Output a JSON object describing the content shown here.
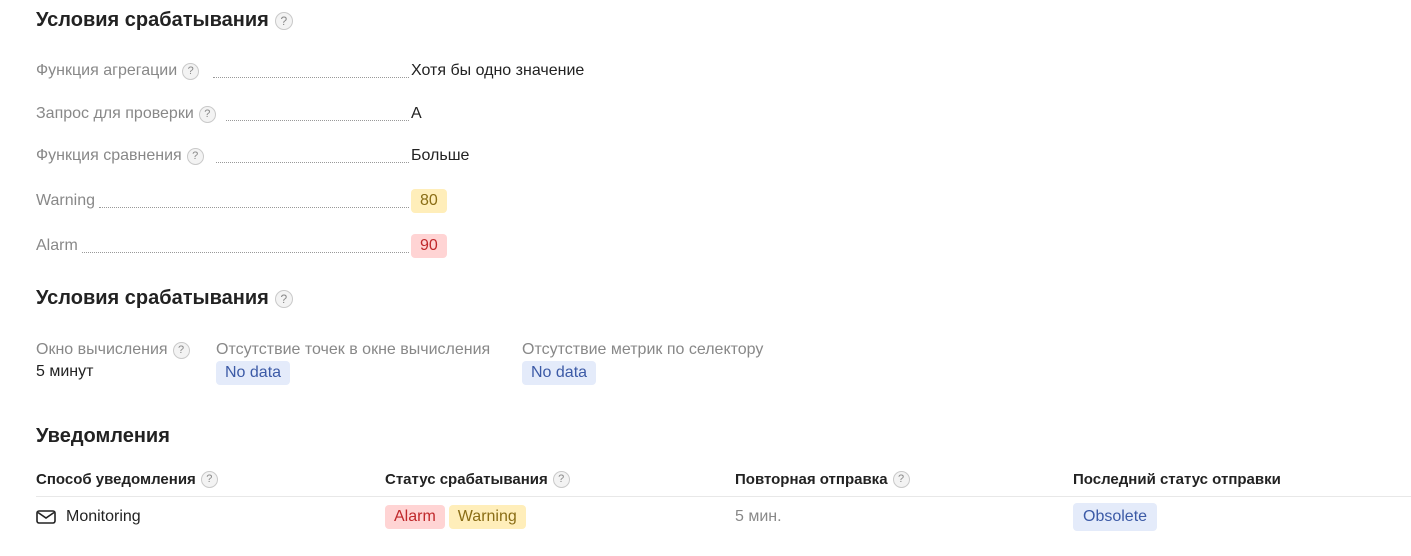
{
  "trigger_conditions": {
    "title": "Условия срабатывания",
    "rows": [
      {
        "label": "Функция агрегации",
        "value": "Хотя бы одно значение"
      },
      {
        "label": "Запрос для проверки",
        "value": "A"
      },
      {
        "label": "Функция сравнения",
        "value": "Больше"
      },
      {
        "label": "Warning",
        "value": "80"
      },
      {
        "label": "Alarm",
        "value": "90"
      }
    ]
  },
  "calc_conditions": {
    "title": "Условия срабатывания",
    "window_label": "Окно вычисления",
    "window_value": "5 минут",
    "no_points_label": "Отсутствие точек в окне вычисления",
    "no_points_value": "No data",
    "no_metrics_label": "Отсутствие метрик по селектору",
    "no_metrics_value": "No data"
  },
  "notifications": {
    "title": "Уведомления",
    "columns": [
      "Способ уведомления",
      "Статус срабатывания",
      "Повторная отправка",
      "Последний статус отправки"
    ],
    "row": {
      "method": "Monitoring",
      "method_icon": "mail-icon",
      "statuses": [
        "Alarm",
        "Warning"
      ],
      "resend": "5 мин.",
      "last_status": "Obsolete"
    }
  },
  "help_glyph": "?",
  "colors": {
    "warning_bg": "#ffeeba",
    "alarm_bg": "#ffd4d4",
    "info_bg": "#e4ebfa"
  }
}
